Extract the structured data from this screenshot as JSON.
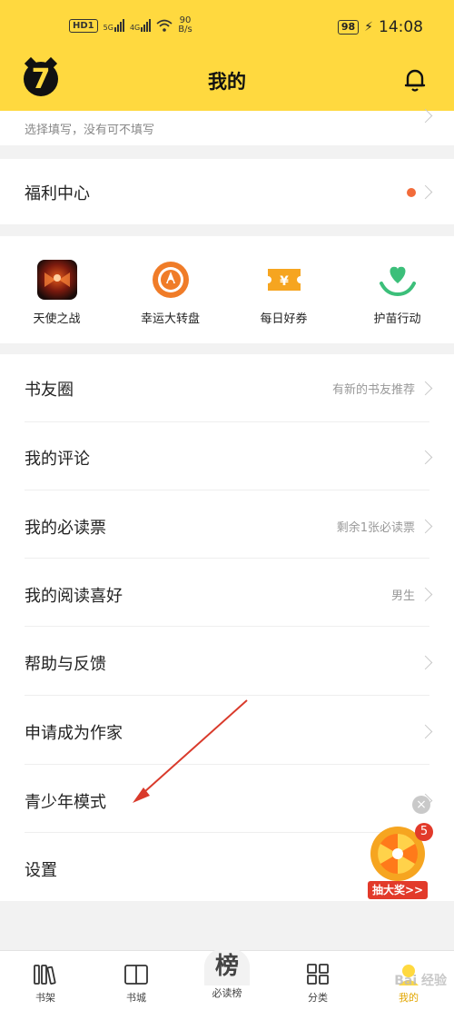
{
  "status_bar": {
    "hd": "HD",
    "hd_sub": "1",
    "sig1": "5G",
    "sig2": "4G",
    "speed_num": "90",
    "speed_unit": "B/s",
    "battery": "98",
    "time": "14:08"
  },
  "header": {
    "title": "我的"
  },
  "top_card": {
    "hint": "选择填写，没有可不填写"
  },
  "welfare": {
    "label": "福利中心"
  },
  "activities": [
    {
      "label": "天使之战",
      "icon": "game-angel-icon"
    },
    {
      "label": "幸运大转盘",
      "icon": "wheel-icon"
    },
    {
      "label": "每日好券",
      "icon": "coupon-icon"
    },
    {
      "label": "护苗行动",
      "icon": "heart-hands-icon"
    }
  ],
  "menu": [
    {
      "label": "书友圈",
      "sub": "有新的书友推荐"
    },
    {
      "label": "我的评论",
      "sub": ""
    },
    {
      "label": "我的必读票",
      "sub": "剩余1张必读票"
    },
    {
      "label": "我的阅读喜好",
      "sub": "男生"
    },
    {
      "label": "帮助与反馈",
      "sub": ""
    },
    {
      "label": "申请成为作家",
      "sub": ""
    },
    {
      "label": "青少年模式",
      "sub": ""
    },
    {
      "label": "设置",
      "sub": ""
    }
  ],
  "fab": {
    "badge": "5",
    "label": "抽大奖>>"
  },
  "tabs": [
    {
      "label": "书架",
      "icon": "bookshelf-icon"
    },
    {
      "label": "书城",
      "icon": "book-icon"
    },
    {
      "label": "必读榜",
      "icon": "rank-icon",
      "glyph": "榜"
    },
    {
      "label": "分类",
      "icon": "grid-icon"
    },
    {
      "label": "我的",
      "icon": "me-icon"
    }
  ],
  "watermark": "Bai 经验",
  "colors": {
    "brand": "#ffd93f",
    "accent_dot": "#f26b3a",
    "arrow": "#d93a2b"
  }
}
